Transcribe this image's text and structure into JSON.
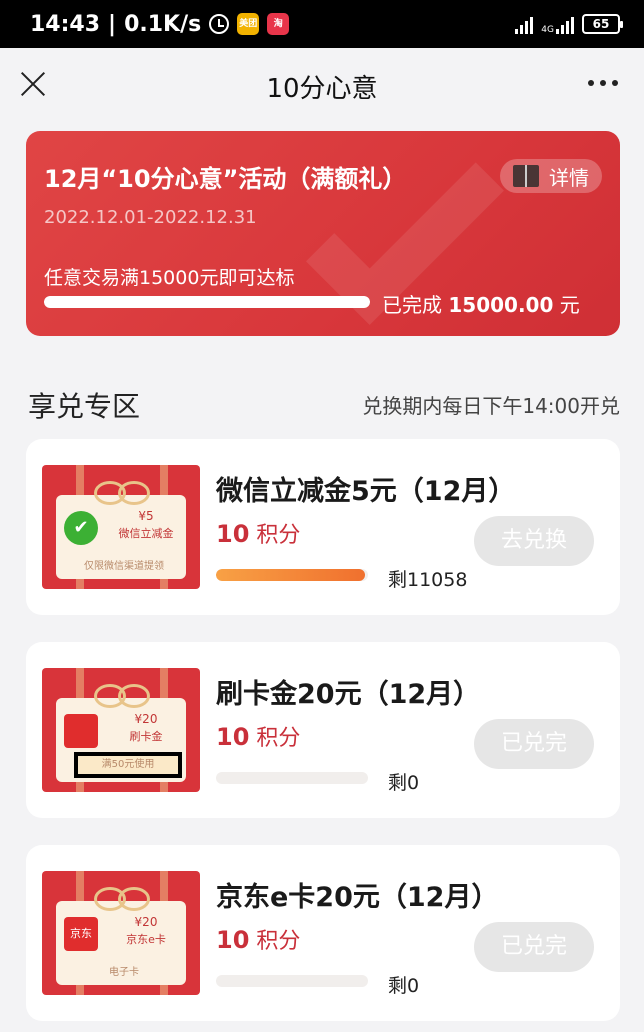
{
  "status_bar": {
    "time": "14:43",
    "speed": "0.1K/s",
    "app_icons": [
      {
        "name": "meituan-icon",
        "label": "美团",
        "color": "#f2b200"
      },
      {
        "name": "taobao-icon",
        "label": "淘",
        "color": "#e8354a"
      }
    ],
    "network": "4G",
    "battery": "65"
  },
  "header": {
    "title": "10分心意"
  },
  "banner": {
    "title": "12月“10分心意”活动（满额礼）",
    "detail_label": "详情",
    "date_range": "2022.12.01-2022.12.31",
    "goal_text": "任意交易满15000元即可达标",
    "progress": 1.0,
    "done_prefix": "已完成",
    "done_amount": "15000.00",
    "done_unit": "元",
    "colors": {
      "bg": "#d8373b"
    }
  },
  "section": {
    "title": "享兑专区",
    "note": "兑换期内每日下午14:00开兑"
  },
  "rewards": [
    {
      "title": "微信立减金5元（12月）",
      "points_value": "10",
      "points_unit": "积分",
      "remaining": "剩11058",
      "stock_fraction": 0.98,
      "button_label": "去兑换",
      "thumb": {
        "logo": "✔",
        "logo_type": "wechat",
        "amount": "¥5",
        "label": "微信立减金",
        "note": "仅限微信渠道提领"
      }
    },
    {
      "title": "刷卡金20元（12月）",
      "points_value": "10",
      "points_unit": "积分",
      "remaining": "剩0",
      "stock_fraction": 0,
      "button_label": "已兑完",
      "thumb": {
        "logo": "",
        "logo_type": "redpacket",
        "amount": "¥20",
        "label": "刷卡金",
        "note": "满50元使用"
      }
    },
    {
      "title": "京东e卡20元（12月）",
      "points_value": "10",
      "points_unit": "积分",
      "remaining": "剩0",
      "stock_fraction": 0,
      "button_label": "已兑完",
      "thumb": {
        "logo": "京东",
        "logo_type": "jd",
        "amount": "¥20",
        "label": "京东e卡",
        "note": "电子卡"
      }
    }
  ]
}
